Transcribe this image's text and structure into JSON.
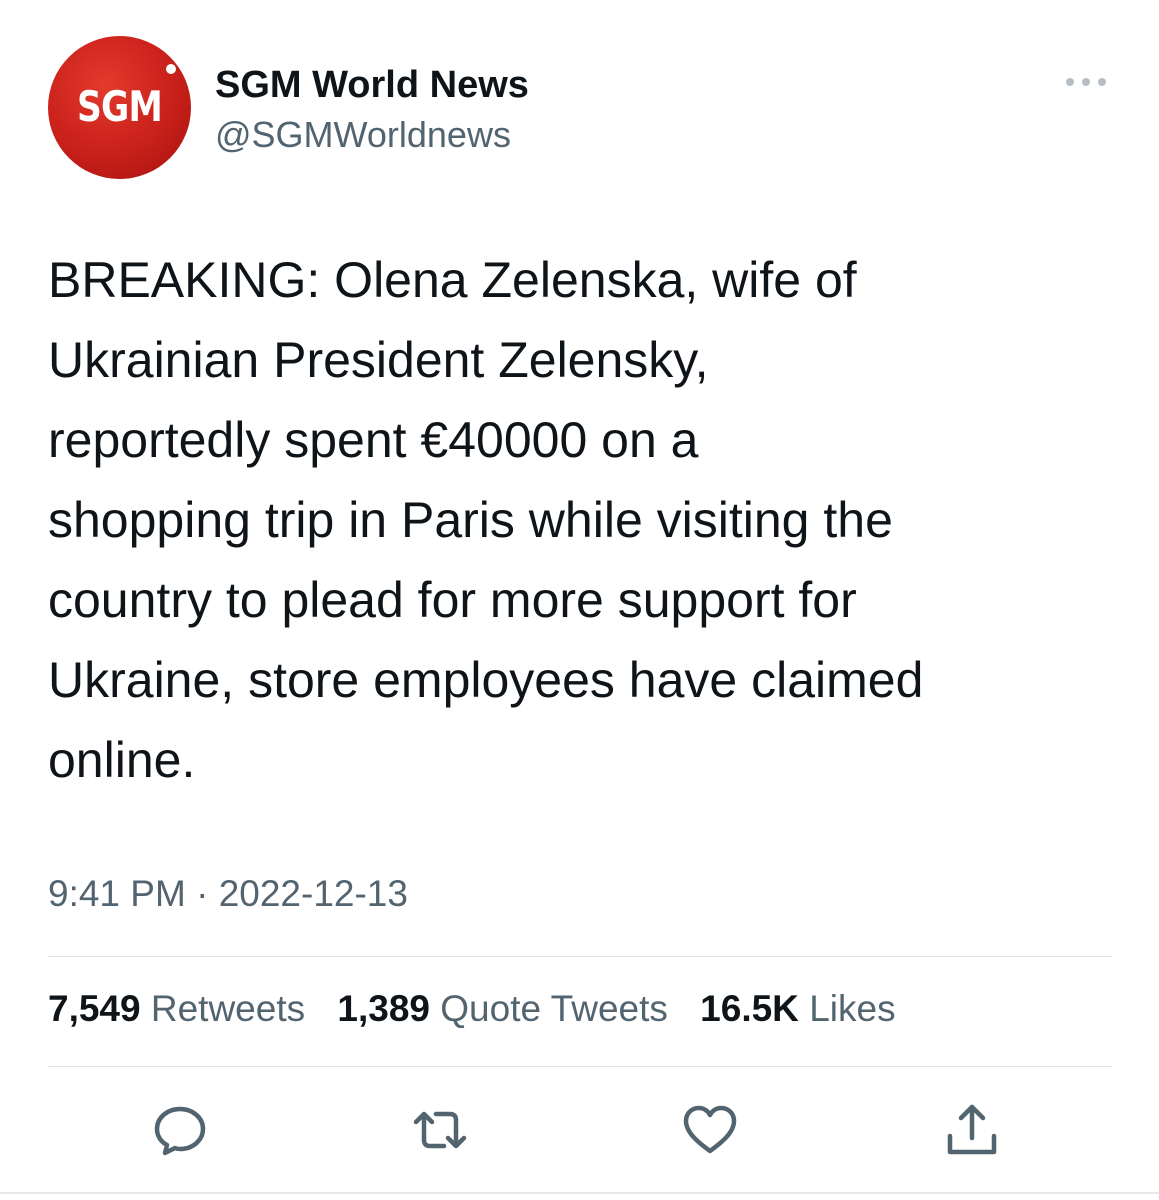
{
  "account": {
    "avatar_text": "SGM",
    "display_name": "SGM World News",
    "handle": "@SGMWorldnews",
    "avatar_color": "#c8201a"
  },
  "tweet": {
    "text": "BREAKING: Olena Zelenska, wife of\nUkrainian President Zelensky,\nreportedly spent €40000 on a\nshopping trip in Paris while visiting the\ncountry to plead for more support for\nUkraine, store employees have claimed\nonline.",
    "time": "9:41 PM",
    "separator": "·",
    "date": "2022-12-13"
  },
  "stats": {
    "retweets_count": "7,549",
    "retweets_label": "Retweets",
    "quotes_count": "1,389",
    "quotes_label": "Quote Tweets",
    "likes_count": "16.5K",
    "likes_label": "Likes"
  },
  "icons": {
    "more": "more-horizontal-icon",
    "reply": "reply-icon",
    "retweet": "retweet-icon",
    "like": "heart-icon",
    "share": "share-icon"
  },
  "colors": {
    "text_primary": "#0f1419",
    "text_secondary": "#536471",
    "divider": "#e1e6ea"
  }
}
